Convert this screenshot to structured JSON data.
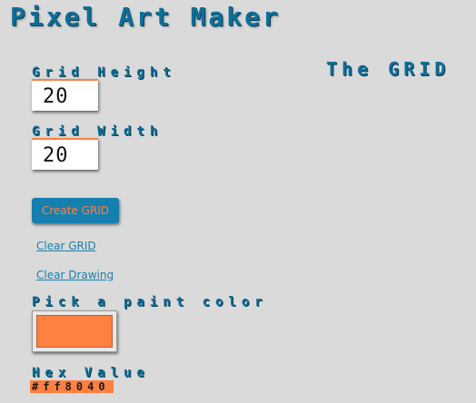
{
  "header": {
    "title": "Pixel Art Maker"
  },
  "grid": {
    "heading": "The GRID"
  },
  "form": {
    "height_label": "Grid Height",
    "height_value": "20",
    "width_label": "Grid Width",
    "width_value": "20",
    "create_label": "Create GRID",
    "clear_grid_label": "Clear GRID",
    "clear_drawing_label": "Clear Drawing",
    "color_label": "Pick a paint color",
    "hex_label": "Hex Value",
    "hex_value": "#ff8040"
  },
  "colors": {
    "accent": "#0d6f99",
    "button": "#1580b0",
    "paint": "#ff8040",
    "background": "#dadada"
  }
}
